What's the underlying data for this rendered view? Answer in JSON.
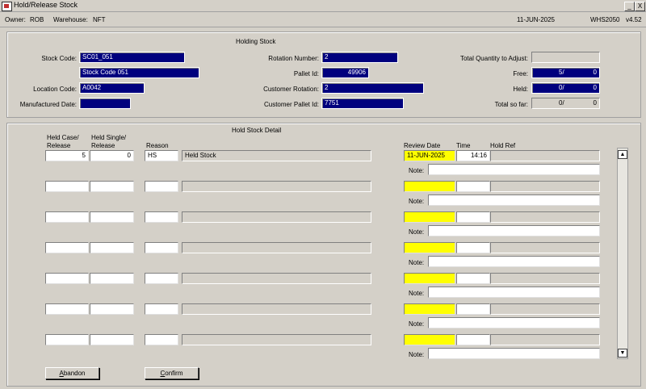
{
  "window": {
    "title": "Hold/Release Stock",
    "minimize": "_",
    "close": "X"
  },
  "infobar": {
    "owner_label": "Owner:",
    "owner": "ROB",
    "warehouse_label": "Warehouse:",
    "warehouse": "NFT",
    "date": "11-JUN-2025",
    "program": "WHS2050",
    "version": "v4.52"
  },
  "holding": {
    "title": "Holding Stock",
    "stock_code_label": "Stock Code:",
    "stock_code": "SC01_051",
    "stock_desc": "Stock Code 051",
    "location_code_label": "Location Code:",
    "location_code": "A0042",
    "manufactured_date_label": "Manufactured Date:",
    "manufactured_date": "",
    "rotation_number_label": "Rotation Number:",
    "rotation_number": "2",
    "pallet_id_label": "Pallet Id:",
    "pallet_id": "49906",
    "customer_rotation_label": "Customer Rotation:",
    "customer_rotation": "2",
    "customer_pallet_id_label": "Customer Pallet Id:",
    "customer_pallet_id": "7751",
    "total_qty_label": "Total Quantity to Adjust:",
    "total_qty": "",
    "free_label": "Free:",
    "free_cases": "5/",
    "free_singles": "0",
    "held_label": "Held:",
    "held_cases": "0/",
    "held_singles": "0",
    "total_so_far_label": "Total so far:",
    "total_cases": "0/",
    "total_singles": "0"
  },
  "detail": {
    "title": "Hold Stock Detail",
    "col_held_case_1": "Held Case/",
    "col_held_case_2": "Release",
    "col_held_single_1": "Held Single/",
    "col_held_single_2": "Release",
    "col_reason": "Reason",
    "col_review_date": "Review Date",
    "col_time": "Time",
    "col_hold_ref": "Hold Ref",
    "note_label": "Note:",
    "rows": [
      {
        "cases": "5",
        "singles": "0",
        "reason": "HS",
        "reason_desc": "Held Stock",
        "review_date": "11-JUN-2025",
        "time": "14:16",
        "hold_ref": "",
        "note": ""
      },
      {
        "cases": "",
        "singles": "",
        "reason": "",
        "reason_desc": "",
        "review_date": "",
        "time": "",
        "hold_ref": "",
        "note": ""
      },
      {
        "cases": "",
        "singles": "",
        "reason": "",
        "reason_desc": "",
        "review_date": "",
        "time": "",
        "hold_ref": "",
        "note": ""
      },
      {
        "cases": "",
        "singles": "",
        "reason": "",
        "reason_desc": "",
        "review_date": "",
        "time": "",
        "hold_ref": "",
        "note": ""
      },
      {
        "cases": "",
        "singles": "",
        "reason": "",
        "reason_desc": "",
        "review_date": "",
        "time": "",
        "hold_ref": "",
        "note": ""
      },
      {
        "cases": "",
        "singles": "",
        "reason": "",
        "reason_desc": "",
        "review_date": "",
        "time": "",
        "hold_ref": "",
        "note": ""
      },
      {
        "cases": "",
        "singles": "",
        "reason": "",
        "reason_desc": "",
        "review_date": "",
        "time": "",
        "hold_ref": "",
        "note": ""
      }
    ]
  },
  "buttons": {
    "abandon_first": "A",
    "abandon_rest": "bandon",
    "confirm_first": "C",
    "confirm_rest": "onfirm"
  },
  "scrollbar": {
    "up": "▲",
    "down": "▼"
  }
}
